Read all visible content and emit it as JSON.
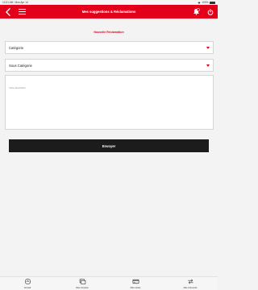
{
  "status_bar": {
    "time": "10:31 AM",
    "date": "Mon Apr 14",
    "battery": "100%"
  },
  "header": {
    "title": "Mes suggestions & Réclamations"
  },
  "form": {
    "subtitle": "Nouvelle Réclamation",
    "category": {
      "value": "Catégorie"
    },
    "subcategory": {
      "value": "Sous Catégorie"
    },
    "description": {
      "placeholder": "Votre description"
    },
    "submit_label": "Envoyer"
  },
  "bottom_nav": [
    {
      "label": "Accueil",
      "icon": "home-icon"
    },
    {
      "label": "Mes comptes",
      "icon": "accounts-icon"
    },
    {
      "label": "Mes cartes",
      "icon": "cards-icon"
    },
    {
      "label": "Mes virements",
      "icon": "transfer-icon"
    }
  ],
  "colors": {
    "accent": "#e3001b",
    "button": "#1c1c1c",
    "background": "#f3f3f3"
  }
}
